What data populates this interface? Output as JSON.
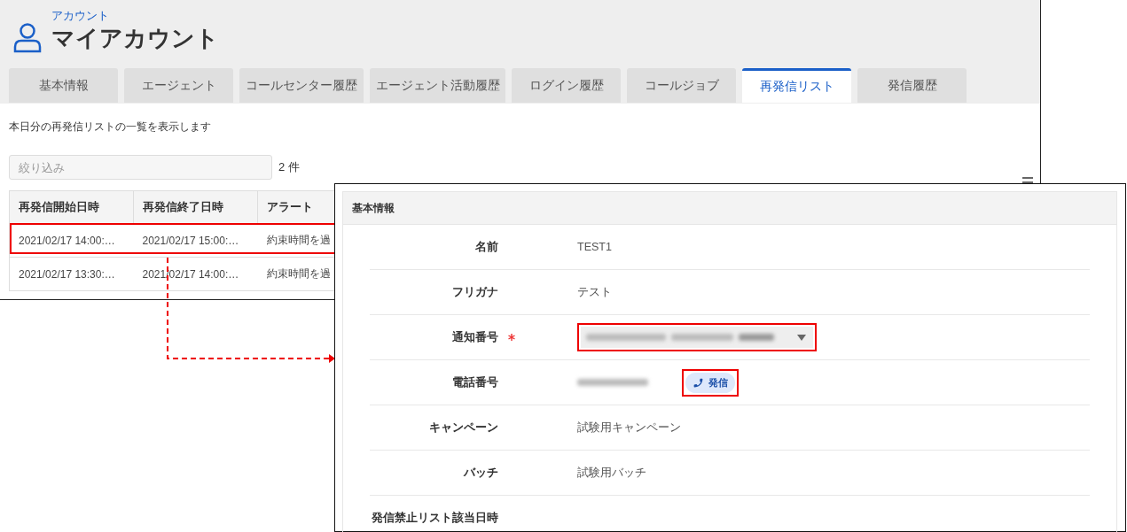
{
  "header": {
    "breadcrumb": "アカウント",
    "title": "マイアカウント"
  },
  "tabs": [
    {
      "label": "基本情報",
      "selected": false
    },
    {
      "label": "エージェント",
      "selected": false
    },
    {
      "label": "コールセンター履歴",
      "selected": false
    },
    {
      "label": "エージェント活動履歴",
      "selected": false
    },
    {
      "label": "ログイン履歴",
      "selected": false
    },
    {
      "label": "コールジョブ",
      "selected": false
    },
    {
      "label": "再発信リスト",
      "selected": true
    },
    {
      "label": "発信履歴",
      "selected": false
    }
  ],
  "description": "本日分の再発信リストの一覧を表示します",
  "filter": {
    "placeholder": "絞り込み"
  },
  "count": "2 件",
  "table": {
    "columns": [
      "再発信開始日時",
      "再発信終了日時",
      "アラート"
    ],
    "rows": [
      {
        "cells": [
          "2021/02/17 14:00:…",
          "2021/02/17 15:00:…",
          "約束時間を過"
        ],
        "highlighted": true
      },
      {
        "cells": [
          "2021/02/17 13:30:…",
          "2021/02/17 14:00:…",
          "約束時間を過"
        ],
        "highlighted": false
      }
    ]
  },
  "detail": {
    "section_title": "基本情報",
    "fields": [
      {
        "kind": "text",
        "label": "名前",
        "value": "TEST1",
        "required": false,
        "highlighted": false
      },
      {
        "kind": "text",
        "label": "フリガナ",
        "value": "テスト",
        "required": false,
        "highlighted": false
      },
      {
        "kind": "select",
        "label": "通知番号",
        "required": true,
        "highlighted": true
      },
      {
        "kind": "phone",
        "label": "電話番号",
        "button_label": "発信",
        "required": false,
        "highlighted": true
      },
      {
        "kind": "text",
        "label": "キャンペーン",
        "value": "試験用キャンペーン",
        "required": false,
        "highlighted": false
      },
      {
        "kind": "text",
        "label": "バッチ",
        "value": "試験用バッチ",
        "required": false,
        "highlighted": false
      },
      {
        "kind": "empty",
        "label": "発信禁止リスト該当日時",
        "required": false,
        "highlighted": false
      }
    ]
  }
}
